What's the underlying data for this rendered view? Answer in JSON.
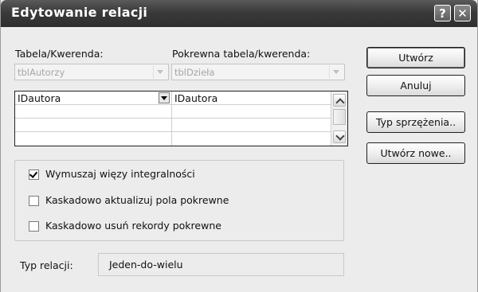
{
  "window": {
    "title": "Edytowanie relacji",
    "help_glyph": "?",
    "close_glyph": "✕"
  },
  "left": {
    "label": "Tabela/Kwerenda:",
    "combo_value": "tblAutorzy"
  },
  "right": {
    "label": "Pokrewna tabela/kwerenda:",
    "combo_value": "tblDzieła"
  },
  "grid": {
    "rows": [
      {
        "left": "IDautora",
        "right": "IDautora"
      },
      {
        "left": "",
        "right": ""
      },
      {
        "left": "",
        "right": ""
      },
      {
        "left": "",
        "right": ""
      }
    ]
  },
  "buttons": {
    "create": "Utwórz",
    "cancel": "Anuluj",
    "join_type": "Typ sprzężenia..",
    "create_new": "Utwórz nowe.."
  },
  "options": {
    "enforce": {
      "label": "Wymuszaj więzy integralności",
      "checked": true
    },
    "cascade_update": {
      "label": "Kaskadowo aktualizuj pola pokrewne",
      "checked": false
    },
    "cascade_delete": {
      "label": "Kaskadowo usuń rekordy pokrewne",
      "checked": false
    }
  },
  "relation": {
    "label": "Typ relacji:",
    "value": "Jeden-do-wielu"
  }
}
